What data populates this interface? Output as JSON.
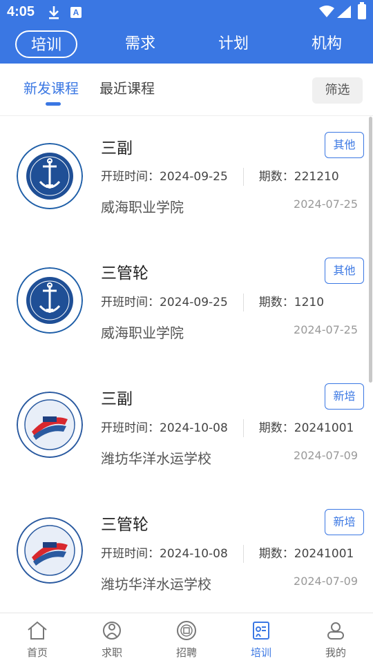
{
  "status_bar": {
    "time": "4:05",
    "notif_letter": "A"
  },
  "top_tabs": [
    {
      "label": "培训"
    },
    {
      "label": "需求"
    },
    {
      "label": "计划"
    },
    {
      "label": "机构"
    }
  ],
  "sub_tabs": [
    {
      "label": "新发课程"
    },
    {
      "label": "最近课程"
    }
  ],
  "filter_label": "筛选",
  "courses": [
    {
      "title": "三副",
      "tag": "其他",
      "start": "开班时间：2024-09-25",
      "period": "期数：221210",
      "school": "威海职业学院",
      "date": "2024-07-25"
    },
    {
      "title": "三管轮",
      "tag": "其他",
      "start": "开班时间：2024-09-25",
      "period": "期数：1210",
      "school": "威海职业学院",
      "date": "2024-07-25"
    },
    {
      "title": "三副",
      "tag": "新培",
      "start": "开班时间：2024-10-08",
      "period": "期数：20241001",
      "school": "潍坊华洋水运学校",
      "date": "2024-07-09"
    },
    {
      "title": "三管轮",
      "tag": "新培",
      "start": "开班时间：2024-10-08",
      "period": "期数：20241001",
      "school": "潍坊华洋水运学校",
      "date": "2024-07-09"
    }
  ],
  "bottom_nav": [
    {
      "label": "首页"
    },
    {
      "label": "求职"
    },
    {
      "label": "招聘"
    },
    {
      "label": "培训"
    },
    {
      "label": "我的"
    }
  ],
  "colors": {
    "accent": "#3a77e3"
  }
}
